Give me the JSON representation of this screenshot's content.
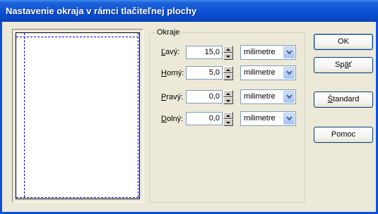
{
  "window": {
    "title": "Nastavenie okraja v rámci tlačiteľnej plochy"
  },
  "group": {
    "legend": "Okraje"
  },
  "margins": [
    {
      "key": "left",
      "label_u": "Ľ",
      "label_rest": "avý:",
      "value": "15,0",
      "unit": "milimetre"
    },
    {
      "key": "top",
      "label_u": "H",
      "label_rest": "orný:",
      "value": "5,0",
      "unit": "milimetre"
    },
    {
      "key": "right",
      "label_u": "P",
      "label_rest": "ravý:",
      "value": "0,0",
      "unit": "milimetre"
    },
    {
      "key": "bottom",
      "label_u": "D",
      "label_rest": "olný:",
      "value": "0,0",
      "unit": "milimetre"
    }
  ],
  "buttons": {
    "ok": "OK",
    "back_pre": "Sp",
    "back_u": "ä",
    "back_post": "ť",
    "standard_u": "Š",
    "standard_rest": "tandard",
    "help": "Pomoc"
  },
  "colors": {
    "titlebar": "#0b50d6",
    "margin_line": "#0000cc",
    "face": "#ece9d8"
  }
}
